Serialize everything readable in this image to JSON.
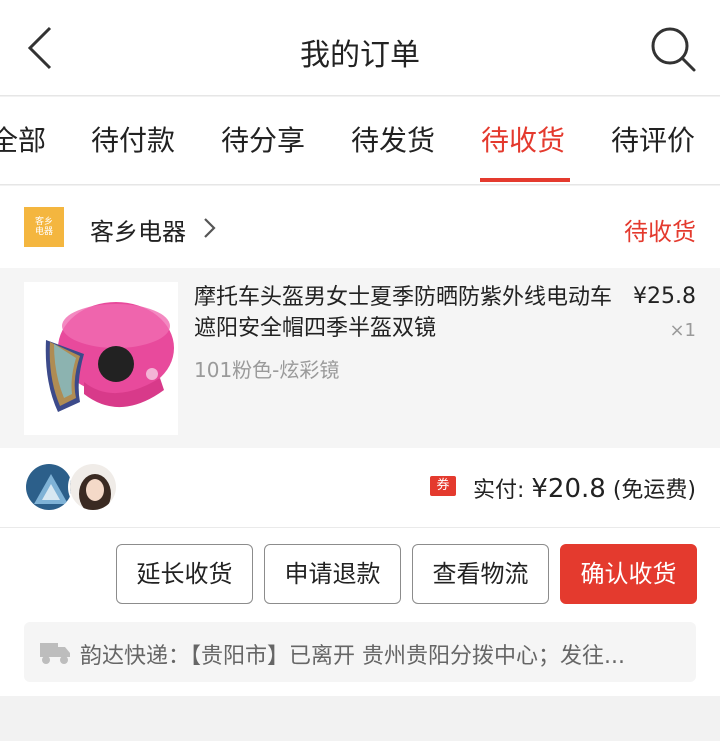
{
  "header": {
    "title": "我的订单"
  },
  "tabs": [
    {
      "label": "全部"
    },
    {
      "label": "待付款"
    },
    {
      "label": "待分享"
    },
    {
      "label": "待发货"
    },
    {
      "label": "待收货"
    },
    {
      "label": "待评价"
    }
  ],
  "active_tab": "待收货",
  "store": {
    "logo_text": "客乡电器",
    "name": "客乡电器",
    "status": "待收货"
  },
  "product": {
    "title": "摩托车头盔男女士夏季防晒防紫外线电动车遮阳安全帽四季半盔双镜",
    "variant": "101粉色-炫彩镜",
    "price": "¥25.8",
    "quantity": "×1"
  },
  "summary": {
    "coupon_badge": "券",
    "paid_label": "实付:",
    "paid_amount": "¥20.8",
    "shipping_note": "(免运费)"
  },
  "actions": {
    "extend": "延长收货",
    "refund": "申请退款",
    "logistics": "查看物流",
    "confirm": "确认收货"
  },
  "logistics": {
    "text": "韵达快递：【贵阳市】已离开 贵州贵阳分拨中心；发往..."
  },
  "colors": {
    "accent": "#e43a2e",
    "logo": "#f4b63f"
  }
}
